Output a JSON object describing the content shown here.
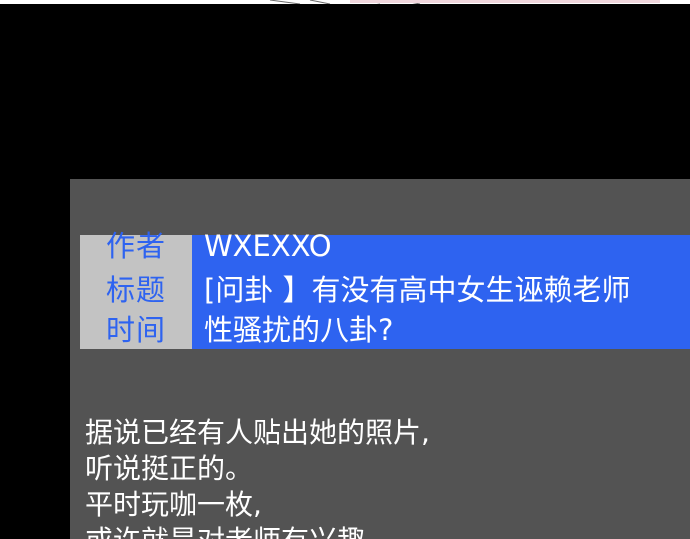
{
  "header": {
    "author_label": "作者",
    "author_value": "WXEXXO",
    "title_label": "标题",
    "title_value": "[问卦 】有没有高中女生诬赖老师",
    "time_label": "时间",
    "time_value": "性骚扰的八卦?"
  },
  "body": {
    "lines": [
      "据说已经有人贴出她的照片,",
      "听说挺正的。",
      "平时玩咖一枚,",
      "或许就是对老师有兴趣"
    ]
  },
  "colors": {
    "background": "#000000",
    "panel": "#535353",
    "label_bg": "#c3c3c3",
    "label_text": "#2e63f0",
    "value_bg": "#2e63f0",
    "value_text": "#ffffff"
  }
}
